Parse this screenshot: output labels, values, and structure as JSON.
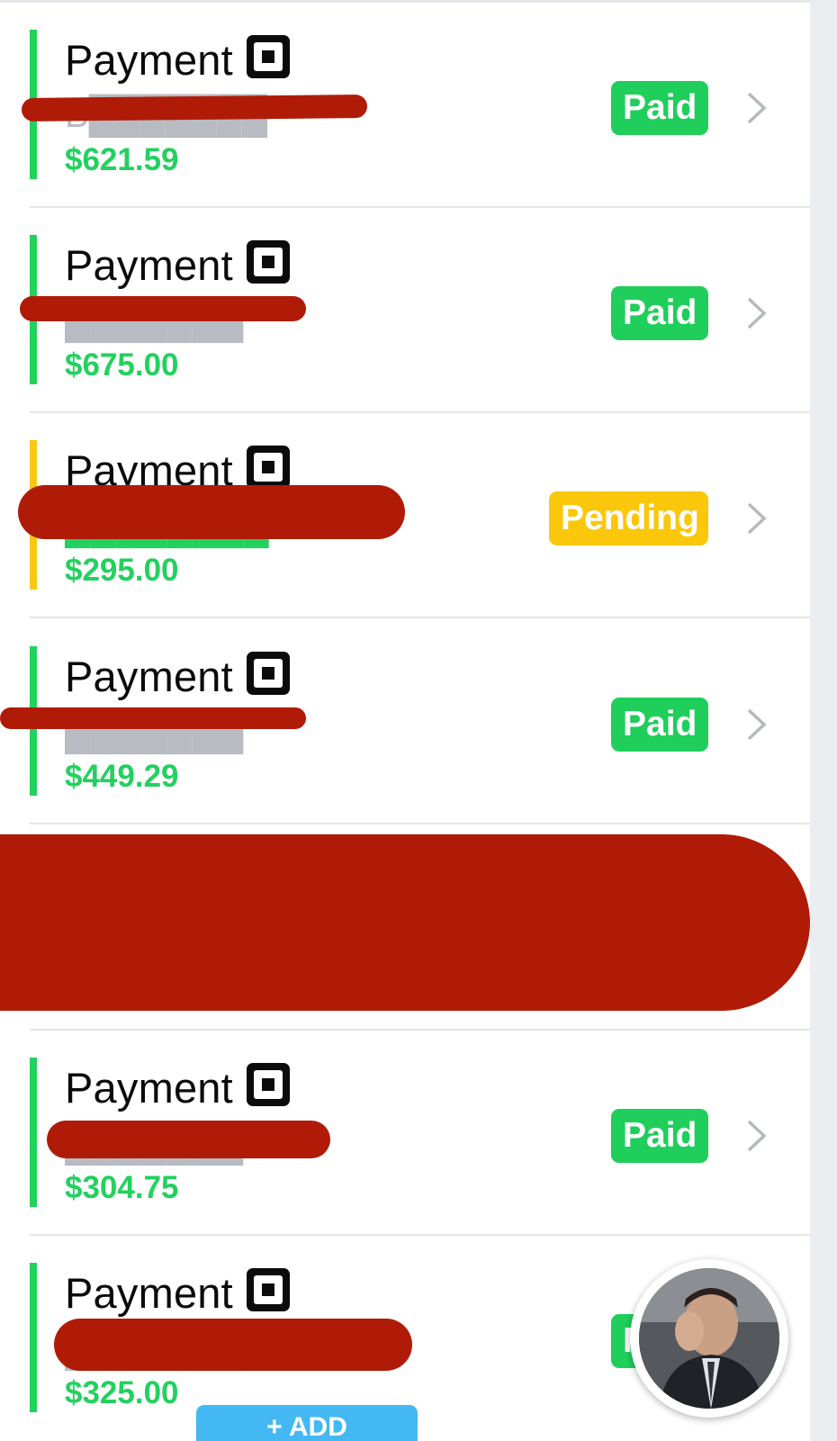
{
  "payments": [
    {
      "title": "Payment",
      "subtitle": "B███████",
      "amount": "$621.59",
      "status": "Paid"
    },
    {
      "title": "Payment",
      "subtitle": "███████",
      "amount": "$675.00",
      "status": "Paid"
    },
    {
      "title": "Payment",
      "subtitle": "████████d...",
      "amount": "$295.00",
      "status": "Pending"
    },
    {
      "title": "Payment",
      "subtitle": "███████",
      "amount": "$449.29",
      "status": "Paid"
    },
    {
      "title": "Payment",
      "subtitle": "███████",
      "amount": "$304.75",
      "status": "Paid"
    },
    {
      "title": "Payment",
      "subtitle": "███████",
      "amount": "$325.00",
      "status": "Paid"
    }
  ],
  "add_button_label": "+ ADD",
  "colors": {
    "paid": "#1fce5b",
    "pending": "#fbc70a",
    "amount": "#22d15e",
    "redaction": "#b01b08",
    "add_button": "#43b8f3"
  },
  "icons": {
    "payment_method": "square-logo-icon",
    "row_action": "chevron-right-icon",
    "chat": "avatar-chat-bubble"
  }
}
